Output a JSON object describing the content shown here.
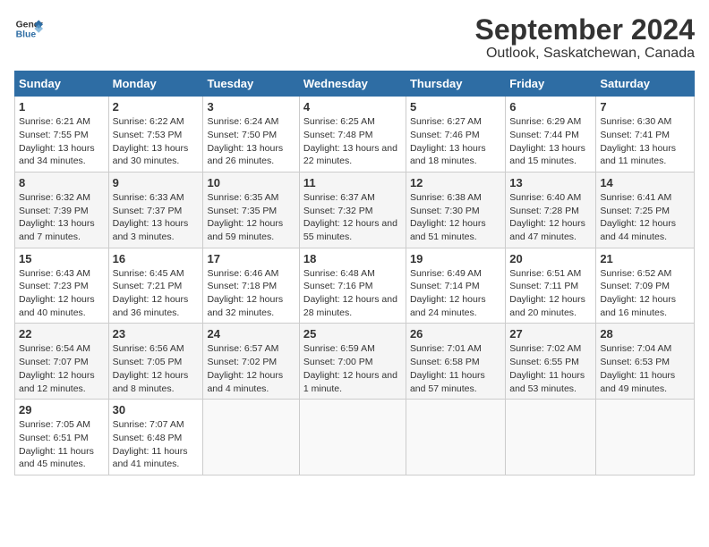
{
  "header": {
    "logo_line1": "General",
    "logo_line2": "Blue",
    "title": "September 2024",
    "subtitle": "Outlook, Saskatchewan, Canada"
  },
  "days_of_week": [
    "Sunday",
    "Monday",
    "Tuesday",
    "Wednesday",
    "Thursday",
    "Friday",
    "Saturday"
  ],
  "weeks": [
    [
      {
        "day": "1",
        "sunrise": "Sunrise: 6:21 AM",
        "sunset": "Sunset: 7:55 PM",
        "daylight": "Daylight: 13 hours and 34 minutes."
      },
      {
        "day": "2",
        "sunrise": "Sunrise: 6:22 AM",
        "sunset": "Sunset: 7:53 PM",
        "daylight": "Daylight: 13 hours and 30 minutes."
      },
      {
        "day": "3",
        "sunrise": "Sunrise: 6:24 AM",
        "sunset": "Sunset: 7:50 PM",
        "daylight": "Daylight: 13 hours and 26 minutes."
      },
      {
        "day": "4",
        "sunrise": "Sunrise: 6:25 AM",
        "sunset": "Sunset: 7:48 PM",
        "daylight": "Daylight: 13 hours and 22 minutes."
      },
      {
        "day": "5",
        "sunrise": "Sunrise: 6:27 AM",
        "sunset": "Sunset: 7:46 PM",
        "daylight": "Daylight: 13 hours and 18 minutes."
      },
      {
        "day": "6",
        "sunrise": "Sunrise: 6:29 AM",
        "sunset": "Sunset: 7:44 PM",
        "daylight": "Daylight: 13 hours and 15 minutes."
      },
      {
        "day": "7",
        "sunrise": "Sunrise: 6:30 AM",
        "sunset": "Sunset: 7:41 PM",
        "daylight": "Daylight: 13 hours and 11 minutes."
      }
    ],
    [
      {
        "day": "8",
        "sunrise": "Sunrise: 6:32 AM",
        "sunset": "Sunset: 7:39 PM",
        "daylight": "Daylight: 13 hours and 7 minutes."
      },
      {
        "day": "9",
        "sunrise": "Sunrise: 6:33 AM",
        "sunset": "Sunset: 7:37 PM",
        "daylight": "Daylight: 13 hours and 3 minutes."
      },
      {
        "day": "10",
        "sunrise": "Sunrise: 6:35 AM",
        "sunset": "Sunset: 7:35 PM",
        "daylight": "Daylight: 12 hours and 59 minutes."
      },
      {
        "day": "11",
        "sunrise": "Sunrise: 6:37 AM",
        "sunset": "Sunset: 7:32 PM",
        "daylight": "Daylight: 12 hours and 55 minutes."
      },
      {
        "day": "12",
        "sunrise": "Sunrise: 6:38 AM",
        "sunset": "Sunset: 7:30 PM",
        "daylight": "Daylight: 12 hours and 51 minutes."
      },
      {
        "day": "13",
        "sunrise": "Sunrise: 6:40 AM",
        "sunset": "Sunset: 7:28 PM",
        "daylight": "Daylight: 12 hours and 47 minutes."
      },
      {
        "day": "14",
        "sunrise": "Sunrise: 6:41 AM",
        "sunset": "Sunset: 7:25 PM",
        "daylight": "Daylight: 12 hours and 44 minutes."
      }
    ],
    [
      {
        "day": "15",
        "sunrise": "Sunrise: 6:43 AM",
        "sunset": "Sunset: 7:23 PM",
        "daylight": "Daylight: 12 hours and 40 minutes."
      },
      {
        "day": "16",
        "sunrise": "Sunrise: 6:45 AM",
        "sunset": "Sunset: 7:21 PM",
        "daylight": "Daylight: 12 hours and 36 minutes."
      },
      {
        "day": "17",
        "sunrise": "Sunrise: 6:46 AM",
        "sunset": "Sunset: 7:18 PM",
        "daylight": "Daylight: 12 hours and 32 minutes."
      },
      {
        "day": "18",
        "sunrise": "Sunrise: 6:48 AM",
        "sunset": "Sunset: 7:16 PM",
        "daylight": "Daylight: 12 hours and 28 minutes."
      },
      {
        "day": "19",
        "sunrise": "Sunrise: 6:49 AM",
        "sunset": "Sunset: 7:14 PM",
        "daylight": "Daylight: 12 hours and 24 minutes."
      },
      {
        "day": "20",
        "sunrise": "Sunrise: 6:51 AM",
        "sunset": "Sunset: 7:11 PM",
        "daylight": "Daylight: 12 hours and 20 minutes."
      },
      {
        "day": "21",
        "sunrise": "Sunrise: 6:52 AM",
        "sunset": "Sunset: 7:09 PM",
        "daylight": "Daylight: 12 hours and 16 minutes."
      }
    ],
    [
      {
        "day": "22",
        "sunrise": "Sunrise: 6:54 AM",
        "sunset": "Sunset: 7:07 PM",
        "daylight": "Daylight: 12 hours and 12 minutes."
      },
      {
        "day": "23",
        "sunrise": "Sunrise: 6:56 AM",
        "sunset": "Sunset: 7:05 PM",
        "daylight": "Daylight: 12 hours and 8 minutes."
      },
      {
        "day": "24",
        "sunrise": "Sunrise: 6:57 AM",
        "sunset": "Sunset: 7:02 PM",
        "daylight": "Daylight: 12 hours and 4 minutes."
      },
      {
        "day": "25",
        "sunrise": "Sunrise: 6:59 AM",
        "sunset": "Sunset: 7:00 PM",
        "daylight": "Daylight: 12 hours and 1 minute."
      },
      {
        "day": "26",
        "sunrise": "Sunrise: 7:01 AM",
        "sunset": "Sunset: 6:58 PM",
        "daylight": "Daylight: 11 hours and 57 minutes."
      },
      {
        "day": "27",
        "sunrise": "Sunrise: 7:02 AM",
        "sunset": "Sunset: 6:55 PM",
        "daylight": "Daylight: 11 hours and 53 minutes."
      },
      {
        "day": "28",
        "sunrise": "Sunrise: 7:04 AM",
        "sunset": "Sunset: 6:53 PM",
        "daylight": "Daylight: 11 hours and 49 minutes."
      }
    ],
    [
      {
        "day": "29",
        "sunrise": "Sunrise: 7:05 AM",
        "sunset": "Sunset: 6:51 PM",
        "daylight": "Daylight: 11 hours and 45 minutes."
      },
      {
        "day": "30",
        "sunrise": "Sunrise: 7:07 AM",
        "sunset": "Sunset: 6:48 PM",
        "daylight": "Daylight: 11 hours and 41 minutes."
      },
      null,
      null,
      null,
      null,
      null
    ]
  ]
}
